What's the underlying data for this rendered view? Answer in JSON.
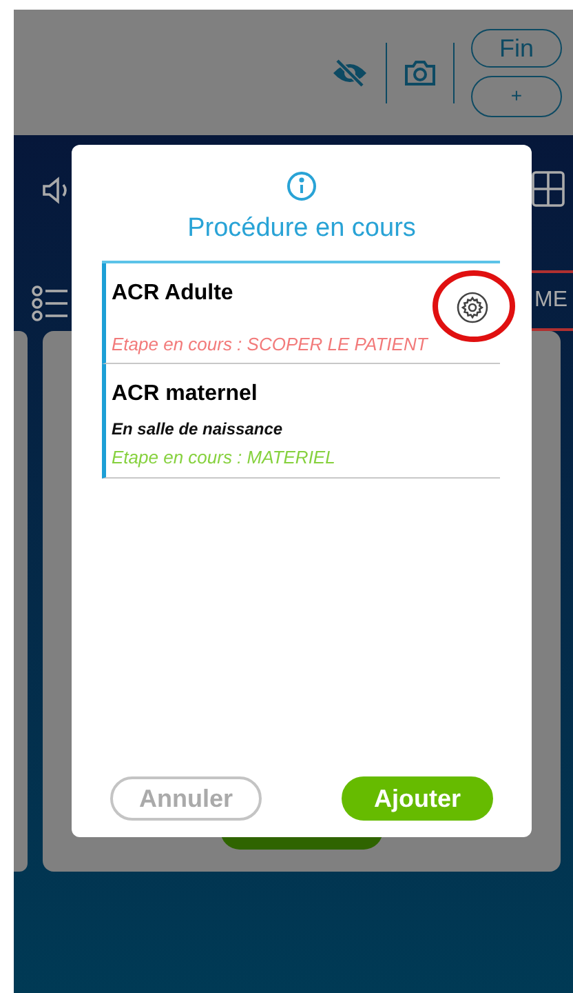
{
  "header": {
    "buttons": [
      "Fin",
      "+"
    ]
  },
  "background": {
    "side_button": "ME"
  },
  "dialog": {
    "title": "Procédure en cours",
    "items": [
      {
        "title": "ACR Adulte",
        "step": "Etape en cours : SCOPER LE PATIENT",
        "color": "#f27a7a",
        "gear": true,
        "circled": true
      },
      {
        "title": "ACR maternel",
        "subtitle": "En salle de naissance",
        "step": "Etape en cours : MATERIEL",
        "color": "#86d13e",
        "gear": false,
        "circled": false
      }
    ],
    "buttons": [
      {
        "label": "Annuler",
        "kind": "secondary"
      },
      {
        "label": "Ajouter",
        "kind": "primary"
      }
    ]
  }
}
